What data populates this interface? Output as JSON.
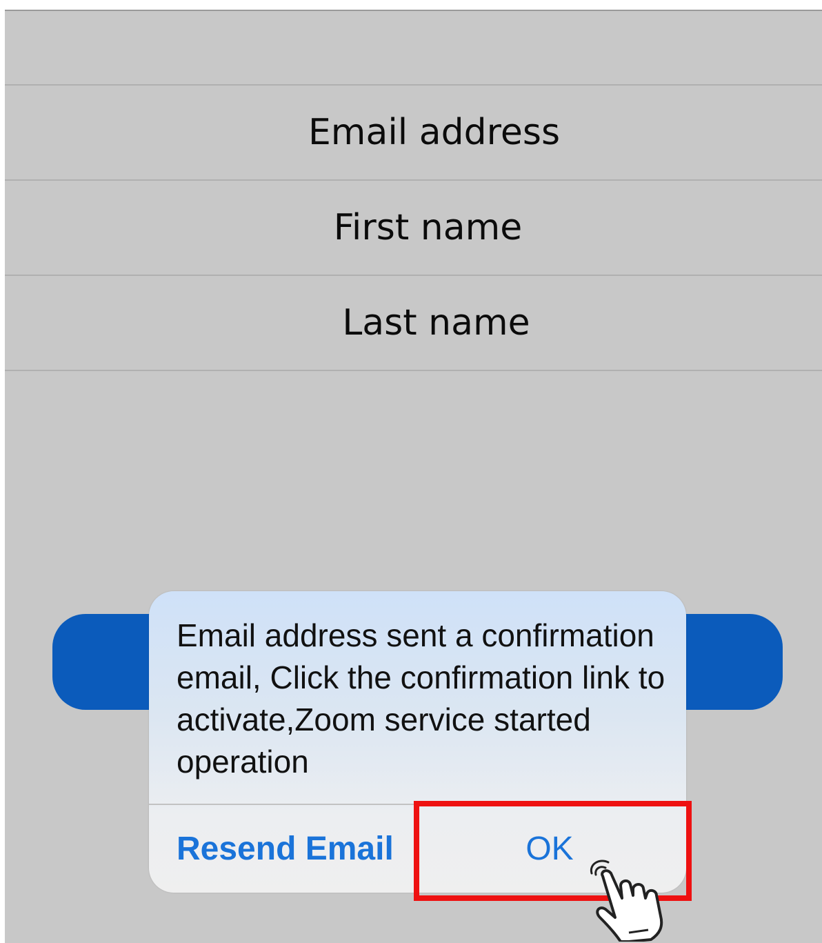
{
  "form": {
    "fields": [
      {
        "label": "Email address"
      },
      {
        "label": "First name"
      },
      {
        "label": "Last name"
      }
    ]
  },
  "dialog": {
    "message": "Email address sent a confirmation email, Click the confirmation link to activate,Zoom service started operation",
    "buttons": {
      "resend": "Resend Email",
      "ok": "OK"
    }
  },
  "colors": {
    "background": "#c8c8c8",
    "primary_button": "#0b5bbb",
    "dialog_link": "#1a73d9",
    "highlight": "#ee1111"
  },
  "icons": {
    "pointer": "tap-hand-icon"
  }
}
